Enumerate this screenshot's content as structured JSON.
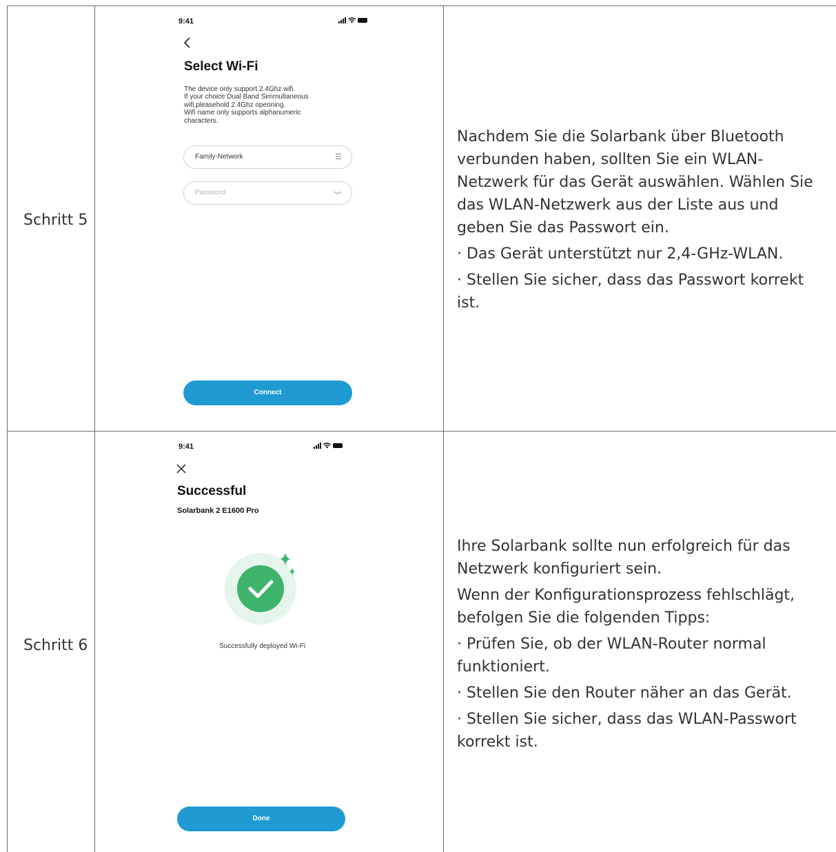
{
  "step5": {
    "label": "Schritt 5",
    "screen": {
      "time": "9:41",
      "title": "Select Wi-Fi",
      "note_lines": [
        "The device only support 2.4Ghz wifi.",
        "If your choice Dual Band Simmultaneous",
        "wifi,pleasehold 2.4Ghz openning.",
        "Wifi name only supports alphanumeric",
        "characters."
      ],
      "network_value": "Family-Network",
      "password_placeholder": "Password",
      "connect_label": "Connect"
    },
    "description": [
      "Nachdem Sie die Solarbank über Bluetooth verbunden haben, sollten Sie ein WLAN-Netzwerk für das Gerät auswählen. Wählen Sie das WLAN-Netzwerk aus der Liste aus und geben Sie das Passwort ein.",
      "· Das Gerät unterstützt nur 2,4-GHz-WLAN.",
      "· Stellen Sie sicher, dass das Passwort korrekt ist."
    ]
  },
  "step6": {
    "label": "Schritt 6",
    "screen": {
      "time": "9:41",
      "title": "Successful",
      "subtitle": "Solarbank 2 E1600 Pro",
      "message": "Successfully deployed Wi-Fi",
      "done_label": "Done"
    },
    "description": [
      "Ihre Solarbank sollte nun erfolgreich für das Netzwerk konfiguriert sein.",
      "Wenn der Konfigurationsprozess fehlschlägt, befolgen Sie die folgenden Tipps:",
      "· Prüfen Sie, ob der WLAN-Router normal funktioniert.",
      "· Stellen Sie den Router näher an das Gerät.",
      "· Stellen Sie sicher, dass das WLAN-Passwort korrekt ist."
    ]
  },
  "colors": {
    "button": "#1f9bd1",
    "success_green": "#3db36b",
    "table_border": "#6b6b6b"
  }
}
